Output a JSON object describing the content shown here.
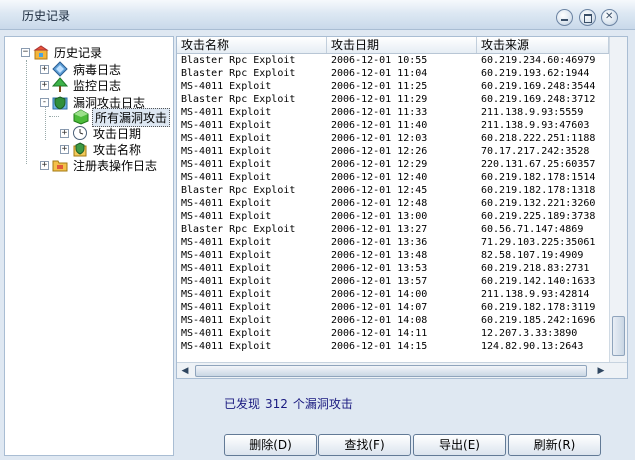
{
  "window": {
    "title": "历史记录"
  },
  "tree": {
    "root": "历史记录",
    "items": [
      {
        "label": "病毒日志",
        "expander": "+"
      },
      {
        "label": "监控日志",
        "expander": "+"
      },
      {
        "label": "漏洞攻击日志",
        "expander": "-"
      },
      {
        "label": "所有漏洞攻击",
        "selected": true
      },
      {
        "label": "攻击日期",
        "expander": "+"
      },
      {
        "label": "攻击名称",
        "expander": "+"
      },
      {
        "label": "注册表操作日志",
        "expander": "+"
      }
    ]
  },
  "table": {
    "columns": [
      "攻击名称",
      "攻击日期",
      "攻击来源"
    ],
    "rows": [
      [
        "Blaster Rpc Exploit",
        "2006-12-01 10:55",
        "60.219.234.60:46979"
      ],
      [
        "Blaster Rpc Exploit",
        "2006-12-01 11:04",
        "60.219.193.62:1944"
      ],
      [
        "MS-4011 Exploit",
        "2006-12-01 11:25",
        "60.219.169.248:3544"
      ],
      [
        "Blaster Rpc Exploit",
        "2006-12-01 11:29",
        "60.219.169.248:3712"
      ],
      [
        "MS-4011 Exploit",
        "2006-12-01 11:33",
        "211.138.9.93:5559"
      ],
      [
        "MS-4011 Exploit",
        "2006-12-01 11:40",
        "211.138.9.93:47603"
      ],
      [
        "MS-4011 Exploit",
        "2006-12-01 12:03",
        "60.218.222.251:1188"
      ],
      [
        "MS-4011 Exploit",
        "2006-12-01 12:26",
        "70.17.217.242:3528"
      ],
      [
        "MS-4011 Exploit",
        "2006-12-01 12:29",
        "220.131.67.25:60357"
      ],
      [
        "MS-4011 Exploit",
        "2006-12-01 12:40",
        "60.219.182.178:1514"
      ],
      [
        "Blaster Rpc Exploit",
        "2006-12-01 12:45",
        "60.219.182.178:1318"
      ],
      [
        "MS-4011 Exploit",
        "2006-12-01 12:48",
        "60.219.132.221:3260"
      ],
      [
        "MS-4011 Exploit",
        "2006-12-01 13:00",
        "60.219.225.189:3738"
      ],
      [
        "Blaster Rpc Exploit",
        "2006-12-01 13:27",
        "60.56.71.147:4869"
      ],
      [
        "MS-4011 Exploit",
        "2006-12-01 13:36",
        "71.29.103.225:35061"
      ],
      [
        "MS-4011 Exploit",
        "2006-12-01 13:48",
        "82.58.107.19:4909"
      ],
      [
        "MS-4011 Exploit",
        "2006-12-01 13:53",
        "60.219.218.83:2731"
      ],
      [
        "MS-4011 Exploit",
        "2006-12-01 13:57",
        "60.219.142.140:1633"
      ],
      [
        "MS-4011 Exploit",
        "2006-12-01 14:00",
        "211.138.9.93:42814"
      ],
      [
        "MS-4011 Exploit",
        "2006-12-01 14:07",
        "60.219.182.178:3119"
      ],
      [
        "MS-4011 Exploit",
        "2006-12-01 14:08",
        "60.219.185.242:1696"
      ],
      [
        "MS-4011 Exploit",
        "2006-12-01 14:11",
        "12.207.3.33:3890"
      ],
      [
        "MS-4011 Exploit",
        "2006-12-01 14:15",
        "124.82.90.13:2643"
      ]
    ]
  },
  "status": {
    "prefix": "已发现",
    "count": "312",
    "suffix": "个漏洞攻击"
  },
  "buttons": {
    "delete": "删除(D)",
    "find": "查找(F)",
    "export": "导出(E)",
    "refresh": "刷新(R)"
  },
  "colors": {
    "accent": "#dfe8f2",
    "selection": "#dde7f2",
    "status_text": "#1a1a80"
  },
  "icons": {
    "root": "folder-box-icon",
    "virus": "diamond-icon",
    "monitor": "tree-icon",
    "exploit": "shield-box-icon",
    "selected": "green-cube-icon",
    "date": "clock-icon",
    "name": "shield-icon",
    "registry": "folder-icon"
  }
}
